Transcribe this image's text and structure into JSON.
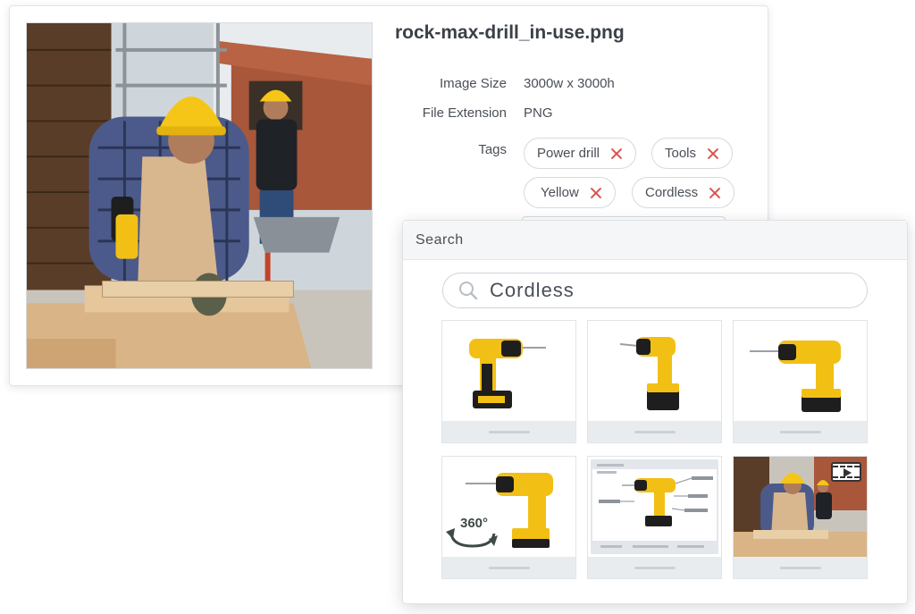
{
  "detail": {
    "file_name": "rock-max-drill_in-use.png",
    "image_size_label": "Image Size",
    "image_size_value": "3000w x 3000h",
    "file_ext_label": "File Extension",
    "file_ext_value": "PNG",
    "tags_label": "Tags",
    "tags": [
      "Power drill",
      "Tools",
      "Yellow",
      "Cordless"
    ],
    "tag_remove_color": "#d9534f"
  },
  "search": {
    "header": "Search",
    "query": "Cordless",
    "results": [
      {
        "kind": "drill-product-left"
      },
      {
        "kind": "drill-product-front"
      },
      {
        "kind": "drill-product-right"
      },
      {
        "kind": "drill-360-view",
        "badge": "360°"
      },
      {
        "kind": "drill-diagram"
      },
      {
        "kind": "video-worksite"
      }
    ]
  },
  "colors": {
    "drill_yellow": "#f2c014",
    "drill_black": "#1e1e1e",
    "hardhat_yellow": "#f5c518"
  }
}
